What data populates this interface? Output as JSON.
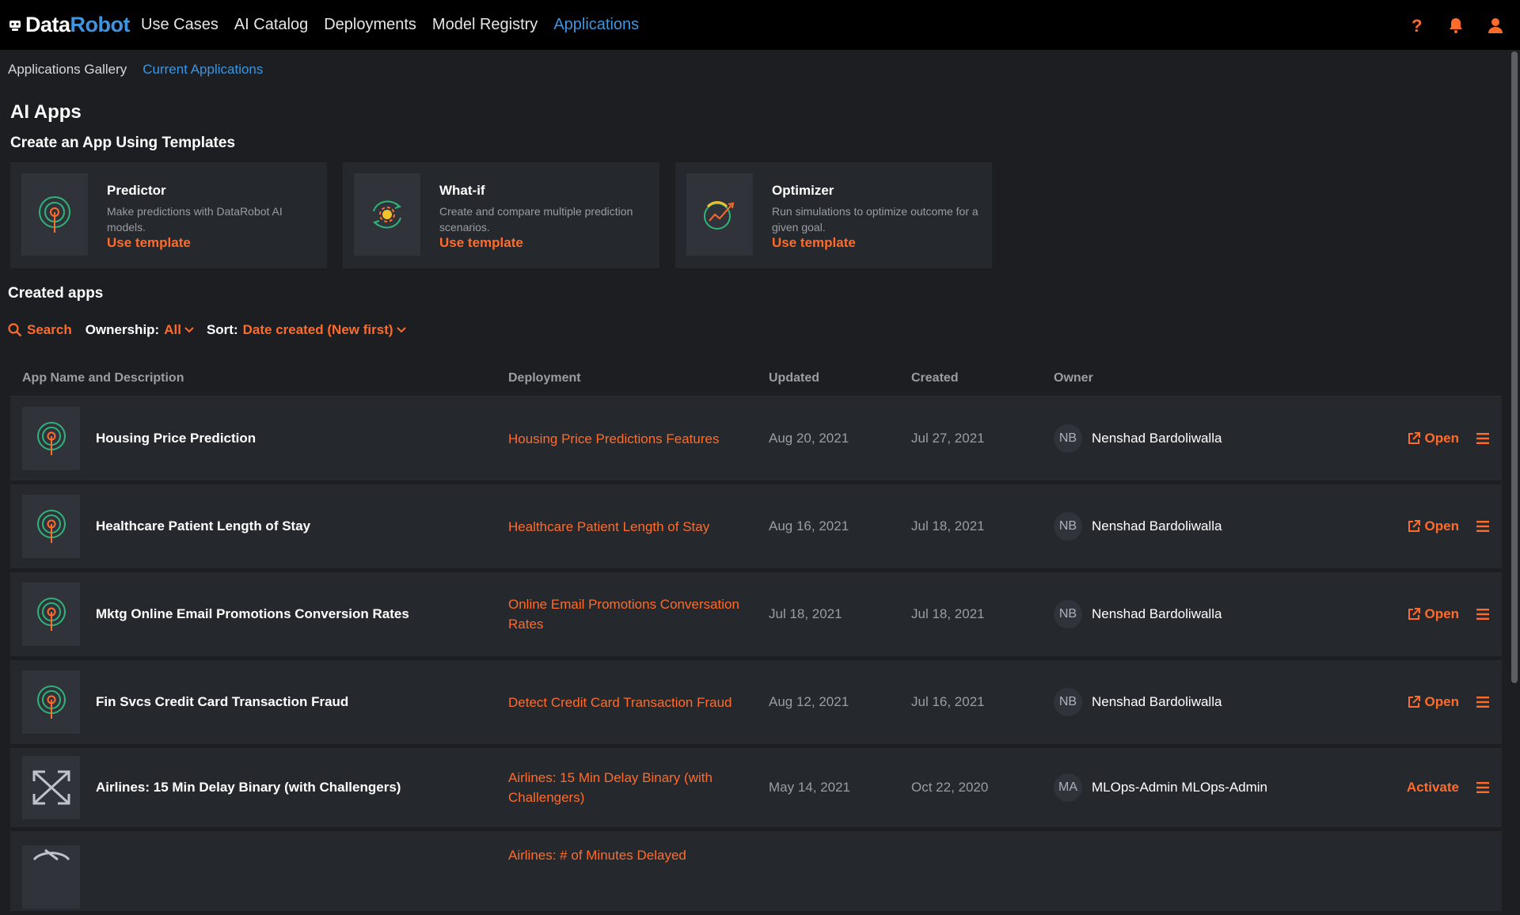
{
  "brand": {
    "part1": "Data",
    "part2": "Robot"
  },
  "nav": [
    {
      "label": "Use Cases"
    },
    {
      "label": "AI Catalog"
    },
    {
      "label": "Deployments"
    },
    {
      "label": "Model Registry"
    },
    {
      "label": "Applications",
      "active": true
    }
  ],
  "top_icons": [
    "help-icon",
    "bell-icon",
    "user-icon"
  ],
  "subnav": [
    {
      "label": "Applications Gallery"
    },
    {
      "label": "Current Applications",
      "active": true
    }
  ],
  "page_title": "AI Apps",
  "templates_title": "Create an App Using Templates",
  "templates": [
    {
      "title": "Predictor",
      "desc": "Make predictions with DataRobot AI models.",
      "link": "Use template",
      "icon": "predictor-icon"
    },
    {
      "title": "What-if",
      "desc": "Create and compare multiple prediction scenarios.",
      "link": "Use template",
      "icon": "what-if-icon"
    },
    {
      "title": "Optimizer",
      "desc": "Run simulations to optimize outcome for a given goal.",
      "link": "Use template",
      "icon": "optimizer-icon"
    }
  ],
  "created_title": "Created apps",
  "filters": {
    "search": "Search",
    "ownership_label": "Ownership:",
    "ownership_value": "All",
    "sort_label": "Sort:",
    "sort_value": "Date created (New first)"
  },
  "table": {
    "headers": [
      "App Name and Description",
      "Deployment",
      "Updated",
      "Created",
      "Owner"
    ],
    "rows": [
      {
        "name": "Housing Price Prediction",
        "deployment": "Housing Price Predictions Features",
        "updated": "Aug 20, 2021",
        "created": "Jul 27, 2021",
        "initials": "NB",
        "owner": "Nenshad Bardoliwalla",
        "action": "Open"
      },
      {
        "name": "Healthcare Patient Length of Stay",
        "deployment": "Healthcare Patient Length of Stay",
        "updated": "Aug 16, 2021",
        "created": "Jul 18, 2021",
        "initials": "NB",
        "owner": "Nenshad Bardoliwalla",
        "action": "Open"
      },
      {
        "name": "Mktg Online Email Promotions Conversion Rates",
        "deployment": "Online Email Promotions Conversation Rates",
        "updated": "Jul 18, 2021",
        "created": "Jul 18, 2021",
        "initials": "NB",
        "owner": "Nenshad Bardoliwalla",
        "action": "Open"
      },
      {
        "name": "Fin Svcs Credit Card Transaction Fraud",
        "deployment": "Detect Credit Card Transaction Fraud",
        "updated": "Aug 12, 2021",
        "created": "Jul 16, 2021",
        "initials": "NB",
        "owner": "Nenshad Bardoliwalla",
        "action": "Open"
      },
      {
        "name": "Airlines: 15 Min Delay Binary (with Challengers)",
        "deployment": "Airlines: 15 Min Delay Binary (with Challengers)",
        "updated": "May 14, 2021",
        "created": "Oct 22, 2020",
        "initials": "MA",
        "owner": "MLOps-Admin MLOps-Admin",
        "action": "Activate"
      },
      {
        "name": "",
        "deployment": "Airlines: # of Minutes Delayed",
        "updated": "",
        "created": "",
        "initials": "",
        "owner": "",
        "action": ""
      }
    ]
  },
  "colors": {
    "accent": "#ff6b2b",
    "link_blue": "#3d95e0",
    "background": "#1c1e21",
    "card": "#25282c"
  }
}
